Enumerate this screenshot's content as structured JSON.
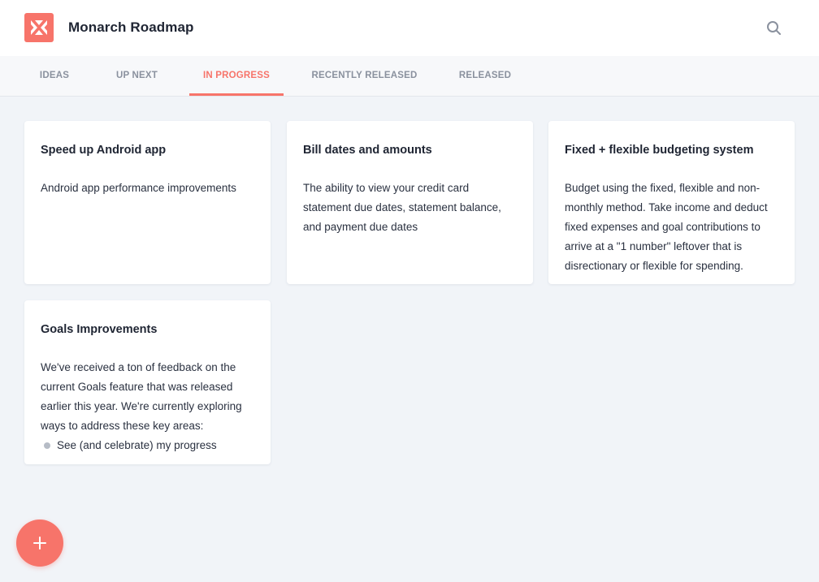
{
  "header": {
    "app_title": "Monarch Roadmap",
    "logo_icon": "monarch-logo-icon",
    "search_icon": "search-icon",
    "brand_color": "#f7746a"
  },
  "tabs": [
    {
      "label": "IDEAS",
      "active": false
    },
    {
      "label": "UP NEXT",
      "active": false
    },
    {
      "label": "IN PROGRESS",
      "active": true
    },
    {
      "label": "RECENTLY RELEASED",
      "active": false
    },
    {
      "label": "RELEASED",
      "active": false
    }
  ],
  "cards": [
    {
      "title": "Speed up Android app",
      "description": "Android app performance improvements"
    },
    {
      "title": "Bill dates and amounts",
      "description": "The ability to view your credit card statement due dates, statement balance, and payment due dates"
    },
    {
      "title": "Fixed + flexible budgeting system",
      "description": "Budget using the fixed, flexible and non-monthly method. Take income and deduct fixed expenses and goal contributions to arrive at a \"1 number\" leftover that is disrectionary or flexible for spending."
    },
    {
      "title": "Goals Improvements",
      "description": "We've received a ton of feedback on the current Goals feature that was released earlier this year. We're currently exploring ways to address these key areas:",
      "bullets": [
        "See (and celebrate) my progress"
      ]
    }
  ],
  "fab": {
    "icon": "plus-icon"
  }
}
